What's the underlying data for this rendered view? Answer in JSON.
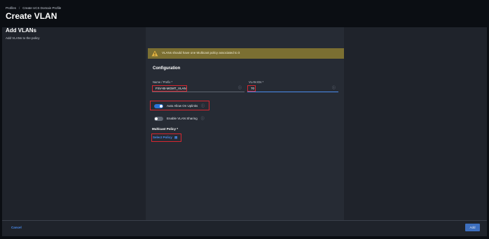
{
  "breadcrumb": {
    "item1": "Profiles",
    "separator": "/",
    "item2": "Create UCS Domain Profile"
  },
  "page": {
    "title": "Create VLAN"
  },
  "section": {
    "title": "Add VLANs",
    "subtitle": "Add VLANs to the policy"
  },
  "alert": {
    "text": "VLANs should have one Multicast policy associated to it",
    "icon": "warning-icon",
    "color": "#7b6f32"
  },
  "configuration": {
    "title": "Configuration",
    "name_prefix": {
      "label": "Name / Prefix *",
      "value": "FSV-IB-MGMT_VLAN"
    },
    "vlan_ids": {
      "label": "VLAN IDs *",
      "value": "70"
    },
    "auto_allow_uplinks": {
      "label": "Auto Allow On Uplinks",
      "state": "on"
    },
    "enable_vlan_sharing": {
      "label": "Enable VLAN Sharing",
      "state": "off"
    },
    "multicast_policy": {
      "label": "Multicast Policy *",
      "link": "Select Policy"
    }
  },
  "footer": {
    "cancel_label": "Cancel",
    "add_label": "Add"
  },
  "colors": {
    "accent": "#4a8df0",
    "highlight": "#d6262f",
    "panel": "#1f232b"
  }
}
